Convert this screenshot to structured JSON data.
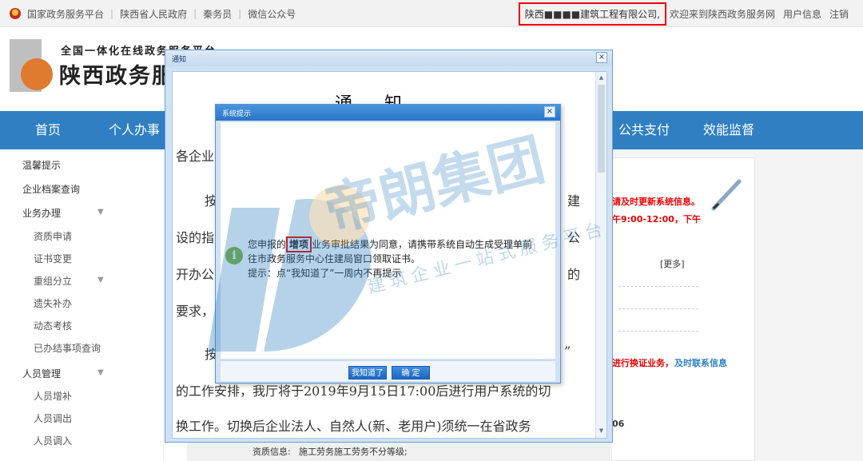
{
  "topbar": {
    "links": [
      "国家政务服务平台",
      "陕西省人民政府",
      "秦务员",
      "微信公众号"
    ],
    "company": "陕西■■■■建筑工程有限公司,",
    "welcome": "欢迎来到陕西政务服务网",
    "user_info": "用户信息",
    "logout": "注销"
  },
  "header": {
    "subtitle": "全国一体化在线政务服务平台",
    "title": "陕西政务服"
  },
  "nav": {
    "items": [
      "首页",
      "个人办事",
      "公共支付",
      "效能监督"
    ]
  },
  "sidebar": {
    "items": [
      {
        "label": "温馨提示"
      },
      {
        "label": "企业档案查询"
      },
      {
        "label": "业务办理"
      },
      {
        "label": "资质申请"
      },
      {
        "label": "证书变更"
      },
      {
        "label": "重组分立"
      },
      {
        "label": "遗失补办"
      },
      {
        "label": "动态考核"
      },
      {
        "label": "已办结事项查询"
      },
      {
        "label": "人员管理"
      },
      {
        "label": "人员增补"
      },
      {
        "label": "人员调出"
      },
      {
        "label": "人员调入"
      }
    ]
  },
  "right_panel": {
    "red1": "请及时更新系统信息。",
    "red2": "午9:00-12:00，下午",
    "more": "[更多]",
    "red3": "进行换证业务，",
    "blue": "及时联系信息",
    "num": "06"
  },
  "bottom_row": {
    "label": "资质信息:",
    "value": "施工劳务施工劳务不分等级;"
  },
  "notice": {
    "window_title": "通知",
    "heading": "通知",
    "lines": [
      "各企业",
      "按",
      "设的指",
      "开办公",
      "要求，",
      "按",
      "的工作安排，我厅将于2019年9月15日17:00后进行用户系统的切",
      "换工作。切换后企业法人、自然人(新、老用户)须统一在省政务"
    ],
    "frag_right1": "建",
    "frag_right2": "公",
    "frag_right3": "的",
    "frag_right4": "”"
  },
  "dialog": {
    "title": "系统提示",
    "line1_before": "您申报的",
    "line1_hl": "增项",
    "line1_after": "业务审批结果为同意，请携带系统自动生成受理单前",
    "line2": "往市政务服务中心住建局窗口领取证书。",
    "line3": "提示：点“我知道了”一周内不再提示",
    "btn_know": "我知道了",
    "btn_ok": "确 定"
  },
  "watermark": {
    "main": "帝朗集团",
    "sub1": "建筑企业一站式服务平台"
  }
}
